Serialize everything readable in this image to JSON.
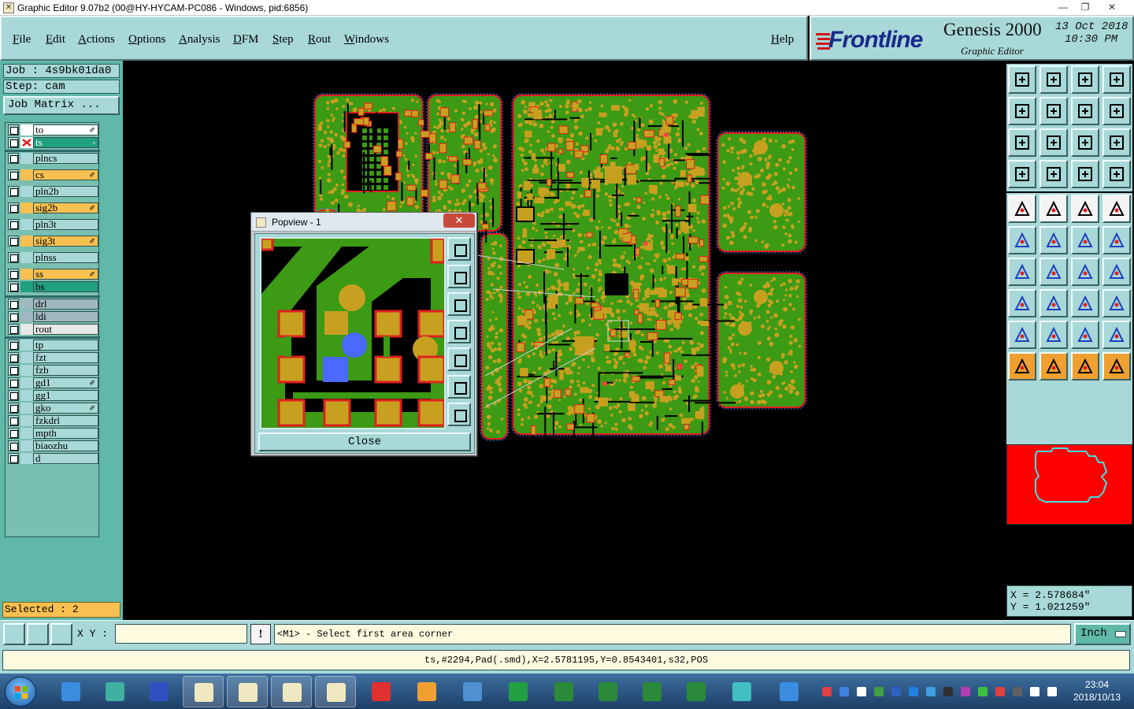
{
  "window": {
    "title": "Graphic Editor 9.07b2 (00@HY-HYCAM-PC086 - Windows, pid:6856)",
    "min": "—",
    "max": "❐",
    "close": "✕"
  },
  "menu": {
    "file": "File",
    "edit": "Edit",
    "actions": "Actions",
    "options": "Options",
    "analysis": "Analysis",
    "dfm": "DFM",
    "step": "Step",
    "rout": "Rout",
    "windows": "Windows",
    "help": "Help"
  },
  "brand": {
    "logo_text": "Frontline",
    "product": "Genesis 2000",
    "subtitle": "Graphic Editor",
    "date": "13 Oct 2018",
    "time": "10:30 PM"
  },
  "job": {
    "job_label": "Job : 4s9bk01da0",
    "step_label": "Step: cam",
    "matrix_button": "Job Matrix ..."
  },
  "layers": [
    {
      "name": "to",
      "color": "#ffffff",
      "mark": "✐"
    },
    {
      "name": "ts",
      "color": "#20a080",
      "mark": "▫"
    },
    {
      "name": "plncs",
      "color": "#a8d8d8",
      "mark": ""
    },
    {
      "name": "cs",
      "color": "#f8c050",
      "mark": "✐"
    },
    {
      "name": "pln2b",
      "color": "#a8d8d8",
      "mark": ""
    },
    {
      "name": "sig2b",
      "color": "#f8c050",
      "mark": "✐"
    },
    {
      "name": "pln3t",
      "color": "#a8d8d8",
      "mark": ""
    },
    {
      "name": "sig3t",
      "color": "#f8c050",
      "mark": "✐"
    },
    {
      "name": "plnss",
      "color": "#a8d8d8",
      "mark": ""
    },
    {
      "name": "ss",
      "color": "#f8c050",
      "mark": "✐"
    },
    {
      "name": "bs",
      "color": "#20a080",
      "mark": ""
    },
    {
      "name": "drl",
      "color": "#a0b8c0",
      "mark": ""
    },
    {
      "name": "ldi",
      "color": "#a0b8c0",
      "mark": ""
    },
    {
      "name": "rout",
      "color": "#e8e8e8",
      "mark": ""
    },
    {
      "name": "tp",
      "color": "#a8d8d8",
      "mark": ""
    },
    {
      "name": "fzt",
      "color": "#a8d8d8",
      "mark": ""
    },
    {
      "name": "fzb",
      "color": "#a8d8d8",
      "mark": ""
    },
    {
      "name": "gd1",
      "color": "#a8d8d8",
      "mark": "✐"
    },
    {
      "name": "gg1",
      "color": "#a8d8d8",
      "mark": ""
    },
    {
      "name": "gko",
      "color": "#a8d8d8",
      "mark": "✐"
    },
    {
      "name": "fzkdrl",
      "color": "#a8d8d8",
      "mark": ""
    },
    {
      "name": "mpth",
      "color": "#a8d8d8",
      "mark": ""
    },
    {
      "name": "biaozhu",
      "color": "#a8d8d8",
      "mark": ""
    },
    {
      "name": "d",
      "color": "#a8d8d8",
      "mark": ""
    }
  ],
  "selected_label": "Selected : 2",
  "popview": {
    "title": "Popview - 1",
    "close_x": "✕",
    "close_button": "Close"
  },
  "coords": {
    "x": "X = 2.578684\"",
    "y": "Y = 1.021259\""
  },
  "command": {
    "xy_label": "X Y :",
    "xy_value": "",
    "warn": "!",
    "prompt": "<M1> - Select first area corner",
    "units": "Inch"
  },
  "status_line": "ts,#2294,Pad(.smd),X=2.5781195,Y=0.8543401,s32,POS",
  "taskbar": {
    "time": "23:04",
    "date": "2018/10/13"
  },
  "colors": {
    "panel": "#a8d8d8",
    "board_green": "#3c9a14",
    "pad_gold": "#c8a020",
    "outline_red": "#e02020"
  }
}
